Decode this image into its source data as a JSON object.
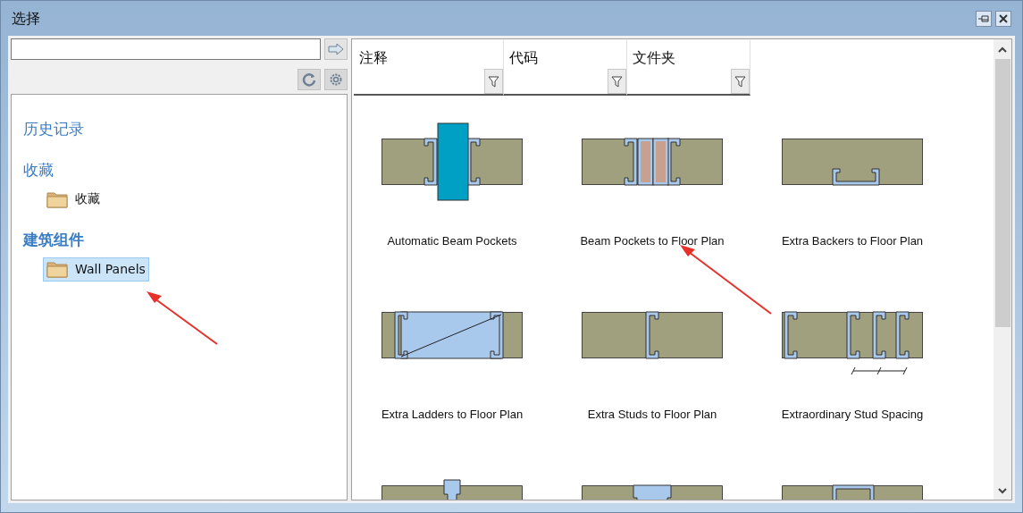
{
  "window": {
    "title": "选择"
  },
  "tree": [
    {
      "label": "历史记录",
      "emphasized": false
    },
    {
      "label": "收藏",
      "emphasized": false,
      "children": [
        {
          "label": "收藏",
          "selected": false
        }
      ]
    },
    {
      "label": "建筑组件",
      "emphasized": true,
      "children": [
        {
          "label": "Wall Panels",
          "selected": true
        }
      ]
    }
  ],
  "columns": [
    {
      "label": "注释"
    },
    {
      "label": "代码"
    },
    {
      "label": "文件夹"
    }
  ],
  "items": [
    {
      "kind": "beam-pocket",
      "label": "Automatic Beam Pockets"
    },
    {
      "kind": "hatched-pocket",
      "label": "Beam Pockets to Floor Plan"
    },
    {
      "kind": "backer",
      "label": "Extra Backers to Floor Plan"
    },
    {
      "kind": "ladder",
      "label": "Extra Ladders to Floor Plan"
    },
    {
      "kind": "stud",
      "label": "Extra Studs to Floor Plan"
    },
    {
      "kind": "stud-spacing",
      "label": "Extraordinary Stud Spacing"
    },
    {
      "kind": "t-stud"
    },
    {
      "kind": "double-stud"
    },
    {
      "kind": "opening"
    }
  ]
}
